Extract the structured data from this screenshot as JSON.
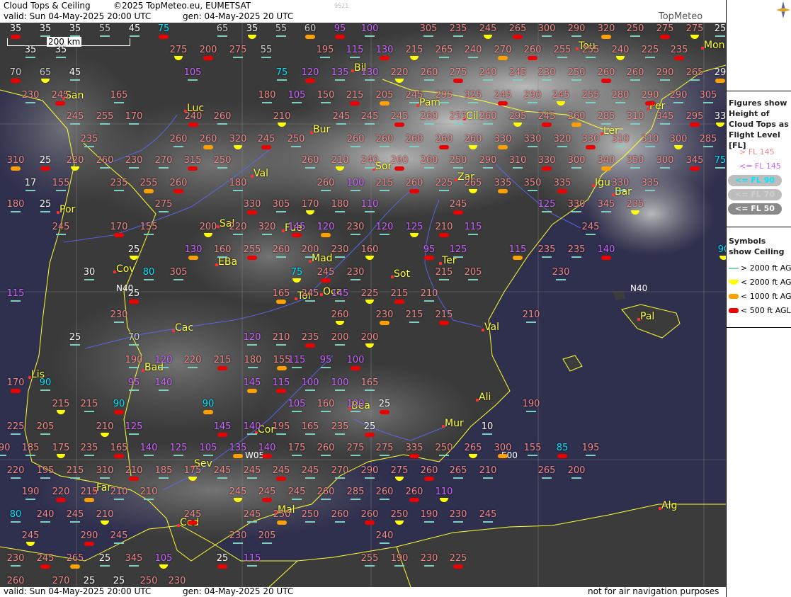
{
  "header": {
    "title": "Cloud Tops & Ceiling",
    "copyright": "©2025 TopMeteo.eu, EUMETSAT",
    "valid": "valid:  Sun  04-May-2025  20:00 UTC",
    "gen": "gen: 04-May-2025 20 UTC",
    "code": "9521"
  },
  "footer": {
    "valid": "valid:  Sun  04-May-2025  20:00 UTC",
    "gen": "gen: 04-May-2025 20 UTC",
    "disclaimer": "not for air navigation purposes"
  },
  "brand": {
    "logo_text": "TopMeteo"
  },
  "map": {
    "scale_label": "200 km",
    "cities": [
      {
        "name": "San"
      },
      {
        "name": "Luc"
      },
      {
        "name": "Bil"
      },
      {
        "name": "Tou"
      },
      {
        "name": "Mon"
      },
      {
        "name": "Pam"
      },
      {
        "name": "Cil"
      },
      {
        "name": "Per"
      },
      {
        "name": "Bur"
      },
      {
        "name": "Ler"
      },
      {
        "name": "Val"
      },
      {
        "name": "Sor"
      },
      {
        "name": "Zar"
      },
      {
        "name": "Igu"
      },
      {
        "name": "Bar"
      },
      {
        "name": "Por"
      },
      {
        "name": "Sal"
      },
      {
        "name": "Fue"
      },
      {
        "name": "Mad"
      },
      {
        "name": "Cov"
      },
      {
        "name": "EBa"
      },
      {
        "name": "Ter"
      },
      {
        "name": "Tol"
      },
      {
        "name": "Oca"
      },
      {
        "name": "Sot"
      },
      {
        "name": "Cac"
      },
      {
        "name": "Val"
      },
      {
        "name": "Pal"
      },
      {
        "name": "Bad"
      },
      {
        "name": "Lis"
      },
      {
        "name": "Bea"
      },
      {
        "name": "Ali"
      },
      {
        "name": "Mur"
      },
      {
        "name": "Cor"
      },
      {
        "name": "Sev"
      },
      {
        "name": "Far"
      },
      {
        "name": "Ced"
      },
      {
        "name": "Mal"
      },
      {
        "name": "Alg"
      }
    ],
    "grid_labels": [
      "N40",
      "N40",
      "W05",
      "E00"
    ],
    "station_values": [
      "35",
      "35",
      "35",
      "55",
      "45",
      "75",
      "65",
      "35",
      "55",
      "60",
      "95",
      "100",
      "305",
      "235",
      "245",
      "265",
      "300",
      "290",
      "320",
      "250",
      "275",
      "275",
      "25",
      "35",
      "35",
      "275",
      "200",
      "275",
      "55",
      "195",
      "115",
      "130",
      "215",
      "265",
      "240",
      "270",
      "260",
      "255",
      "255",
      "240",
      "225",
      "235",
      "70",
      "65",
      "45",
      "105",
      "75",
      "120",
      "135",
      "130",
      "220",
      "260",
      "275",
      "240",
      "245",
      "230",
      "250",
      "260",
      "260",
      "290",
      "265",
      "29",
      "230",
      "245",
      "165",
      "180",
      "105",
      "150",
      "215",
      "205",
      "245",
      "295",
      "325",
      "245",
      "290",
      "245",
      "255",
      "280",
      "290",
      "290",
      "305",
      "245",
      "255",
      "170",
      "240",
      "260",
      "210",
      "245",
      "245",
      "245",
      "260",
      "255",
      "260",
      "295",
      "245",
      "260",
      "285",
      "310",
      "345",
      "295",
      "33",
      "235",
      "260",
      "260",
      "320",
      "245",
      "250",
      "260",
      "260",
      "260",
      "260",
      "260",
      "330",
      "330",
      "320",
      "330",
      "310",
      "310",
      "300",
      "285",
      "310",
      "25",
      "220",
      "260",
      "230",
      "270",
      "315",
      "250",
      "260",
      "210",
      "240",
      "260",
      "260",
      "250",
      "290",
      "310",
      "330",
      "300",
      "340",
      "350",
      "300",
      "345",
      "75",
      "17",
      "155",
      "235",
      "255",
      "260",
      "180",
      "260",
      "100",
      "215",
      "260",
      "225",
      "265",
      "335",
      "350",
      "335",
      "330",
      "335",
      "180",
      "25",
      "275",
      "330",
      "305",
      "170",
      "180",
      "110",
      "245",
      "125",
      "330",
      "345",
      "235",
      "245",
      "170",
      "155",
      "200",
      "220",
      "320",
      "145",
      "120",
      "230",
      "120",
      "125",
      "210",
      "115",
      "245",
      "25",
      "130",
      "160",
      "255",
      "260",
      "200",
      "230",
      "160",
      "95",
      "125",
      "115",
      "235",
      "235",
      "140",
      "90",
      "30",
      "80",
      "305",
      "75",
      "245",
      "230",
      "215",
      "205",
      "230",
      "115",
      "25",
      "165",
      "245",
      "145",
      "225",
      "215",
      "210",
      "230",
      "260",
      "230",
      "215",
      "215",
      "210",
      "25",
      "70",
      "120",
      "210",
      "235",
      "200",
      "200",
      "190",
      "120",
      "220",
      "215",
      "180",
      "155",
      "115",
      "95",
      "100",
      "170",
      "90",
      "95",
      "140",
      "145",
      "115",
      "100",
      "100",
      "165",
      "215",
      "215",
      "90",
      "90",
      "105",
      "160",
      "100",
      "25",
      "190",
      "225",
      "205",
      "210",
      "125",
      "145",
      "140",
      "195",
      "165",
      "235",
      "25",
      "10",
      "190",
      "185",
      "175",
      "235",
      "165",
      "140",
      "125",
      "105",
      "135",
      "140",
      "175",
      "260",
      "275",
      "275",
      "335",
      "250",
      "265",
      "300",
      "155",
      "85",
      "195",
      "220",
      "195",
      "215",
      "310",
      "210",
      "185",
      "175",
      "245",
      "245",
      "245",
      "245",
      "270",
      "290",
      "275",
      "260",
      "265",
      "210",
      "265",
      "200",
      "190",
      "220",
      "215",
      "210",
      "210",
      "245",
      "245",
      "245",
      "260",
      "285",
      "260",
      "260",
      "110",
      "80",
      "240",
      "245",
      "210",
      "245",
      "245",
      "250",
      "250",
      "260",
      "260",
      "250",
      "190",
      "230",
      "245",
      "245",
      "290",
      "245",
      "230",
      "205",
      "240",
      "230",
      "245",
      "265",
      "25",
      "345",
      "105",
      "25",
      "115",
      "255",
      "190",
      "230",
      "225",
      "260",
      "270",
      "25",
      "25",
      "250",
      "230"
    ]
  },
  "legend": {
    "figures_title": "Figures show Height of Cloud Tops as Flight Level  [FL]",
    "fl_items": [
      {
        "label": "> FL 145",
        "color": "#f08a8a"
      },
      {
        "label": "<= FL 145",
        "color": "#cc66ff"
      },
      {
        "label": "<= FL 90",
        "color": "#00e8ff"
      },
      {
        "label": "<= FL 70",
        "color": "#cfcfcf"
      },
      {
        "label": "<= FL 50",
        "color": "#ffffff"
      }
    ],
    "symbols_title": "Symbols show Ceiling",
    "ceiling_items": [
      {
        "label": "> 2000 ft AGL",
        "color": "#7fd0c0"
      },
      {
        "label": "< 2000 ft AGL",
        "color": "#ffff00"
      },
      {
        "label": "< 1000 ft AGL",
        "color": "#ffa000"
      },
      {
        "label": "< 500 ft AGL",
        "color": "#ee0000"
      }
    ]
  },
  "colors": {
    "coast": "#ffff33",
    "rivers": "#5577ff",
    "sea": "#2c2c4a",
    "land": "#333333"
  }
}
